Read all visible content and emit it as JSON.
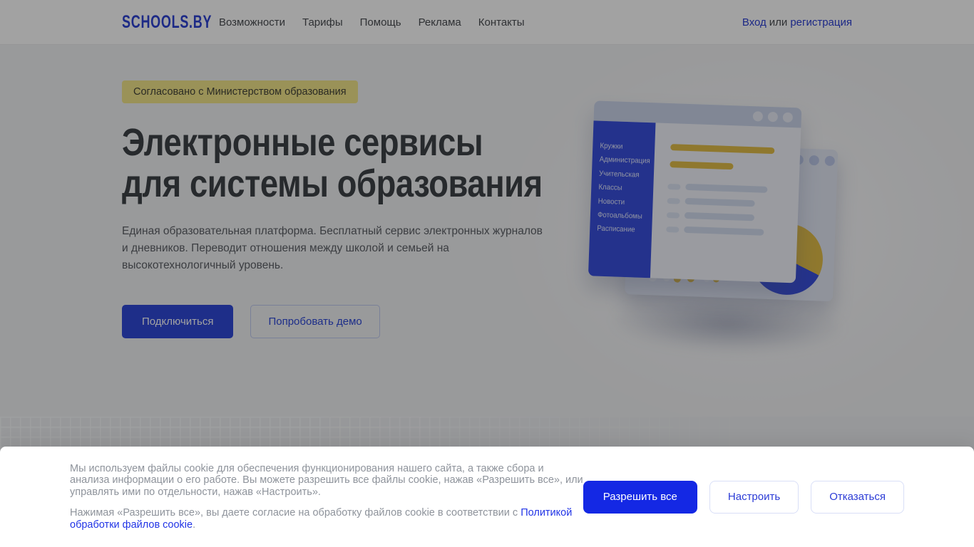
{
  "header": {
    "logo": "SCHOOLS.BY",
    "nav": [
      "Возможности",
      "Тарифы",
      "Помощь",
      "Реклама",
      "Контакты"
    ],
    "auth": {
      "login": "Вход",
      "or": "или",
      "register": "регистрация"
    }
  },
  "hero": {
    "badge": "Согласовано с Министерством образования",
    "title_line1": "Электронные сервисы",
    "title_line2": "для системы образования",
    "description": "Единая образовательная платформа. Бесплатный сервис электронных журналов и дневников. Переводит отношения между школой и семьей на высокотехнологичный уровень.",
    "primary_button": "Подключиться",
    "secondary_button": "Попробовать демо"
  },
  "illustration": {
    "sidebar_items": [
      "Кружки",
      "Администрация",
      "Учительская",
      "Классы",
      "Новости",
      "Фотоальбомы",
      "Расписание"
    ]
  },
  "cookie_banner": {
    "paragraph1": "Мы используем файлы cookie для обеспечения функционирования нашего сайта, а также сбора и анализа информации о его работе. Вы можете разрешить все файлы cookie, нажав «Разрешить все», или управлять ими по отдельности, нажав «Настроить».",
    "paragraph2_prefix": "Нажимая «Разрешить все», вы даете согласие на обработку файлов cookie в соответствии с ",
    "policy_link": "Политикой обработки файлов cookie",
    "paragraph2_suffix": ".",
    "buttons": {
      "allow": "Разрешить все",
      "configure": "Настроить",
      "decline": "Отказаться"
    }
  },
  "colors": {
    "brand_blue": "#3049D8",
    "cookie_accent_blue": "#1428E4",
    "badge_yellow": "#F3E68B",
    "illustration_blue": "#3A50DC",
    "illustration_yellow": "#E2BE49"
  }
}
